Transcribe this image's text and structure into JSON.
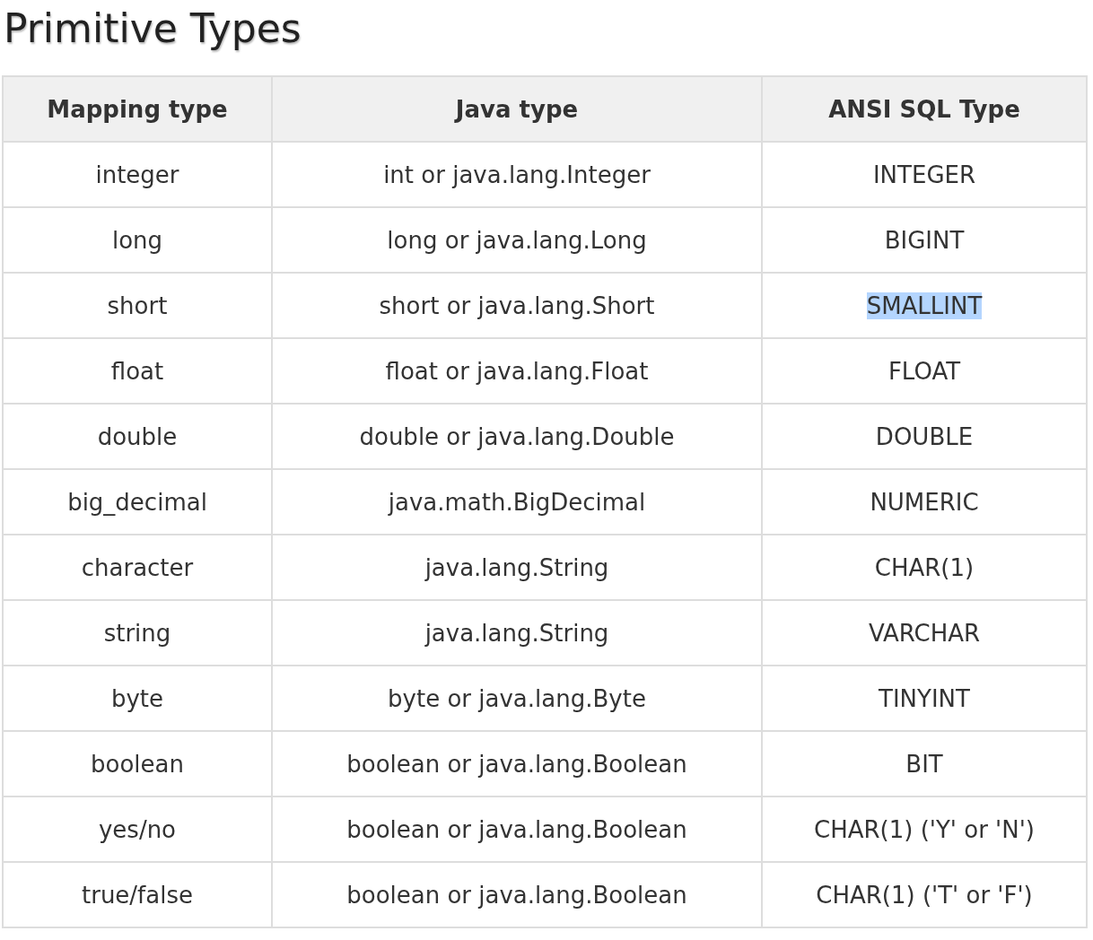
{
  "title": "Primitive Types",
  "table": {
    "columns": [
      "Mapping type",
      "Java type",
      "ANSI SQL Type"
    ],
    "rows": [
      {
        "cells": [
          "integer",
          "int or java.lang.Integer",
          "INTEGER"
        ],
        "highlighted": false
      },
      {
        "cells": [
          "long",
          "long or java.lang.Long",
          "BIGINT"
        ],
        "highlighted": false
      },
      {
        "cells": [
          "short",
          "short or java.lang.Short",
          "SMALLINT"
        ],
        "highlighted": true
      },
      {
        "cells": [
          "float",
          "float or java.lang.Float",
          "FLOAT"
        ],
        "highlighted": false
      },
      {
        "cells": [
          "double",
          "double or java.lang.Double",
          "DOUBLE"
        ],
        "highlighted": false
      },
      {
        "cells": [
          "big_decimal",
          "java.math.BigDecimal",
          "NUMERIC"
        ],
        "highlighted": false
      },
      {
        "cells": [
          "character",
          "java.lang.String",
          "CHAR(1)"
        ],
        "highlighted": false
      },
      {
        "cells": [
          "string",
          "java.lang.String",
          "VARCHAR"
        ],
        "highlighted": false
      },
      {
        "cells": [
          "byte",
          "byte or java.lang.Byte",
          "TINYINT"
        ],
        "highlighted": false
      },
      {
        "cells": [
          "boolean",
          "boolean or java.lang.Boolean",
          "BIT"
        ],
        "highlighted": false
      },
      {
        "cells": [
          "yes/no",
          "boolean or java.lang.Boolean",
          "CHAR(1) ('Y' or 'N')"
        ],
        "highlighted": false
      },
      {
        "cells": [
          "true/false",
          "boolean or java.lang.Boolean",
          "CHAR(1) ('T' or 'F')"
        ],
        "highlighted": false
      }
    ]
  }
}
